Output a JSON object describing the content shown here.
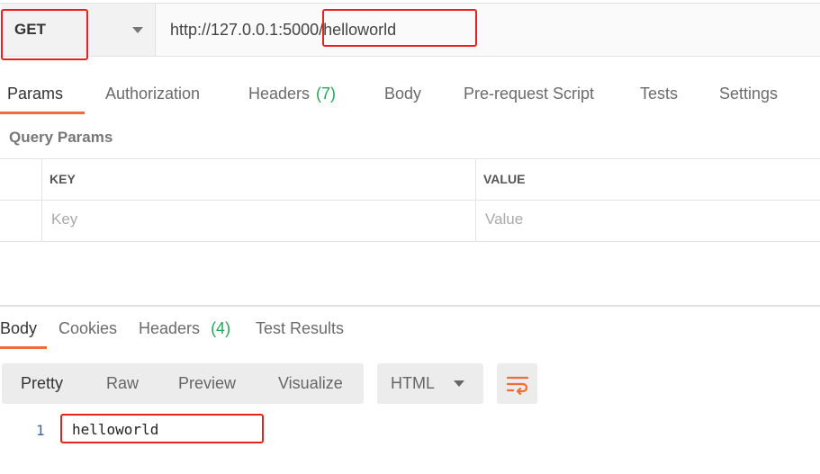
{
  "request": {
    "method": "GET",
    "url": "http://127.0.0.1:5000/helloworld"
  },
  "request_tabs": [
    {
      "label": "Params",
      "count": "",
      "active": true
    },
    {
      "label": "Authorization",
      "count": ""
    },
    {
      "label": "Headers",
      "count": "(7)"
    },
    {
      "label": "Body",
      "count": ""
    },
    {
      "label": "Pre-request Script",
      "count": ""
    },
    {
      "label": "Tests",
      "count": ""
    },
    {
      "label": "Settings",
      "count": ""
    }
  ],
  "query_params": {
    "title": "Query Params",
    "columns": [
      "KEY",
      "VALUE"
    ],
    "placeholders": [
      "Key",
      "Value"
    ]
  },
  "response_tabs": [
    {
      "label": "Body",
      "count": "",
      "active": true
    },
    {
      "label": "Cookies",
      "count": ""
    },
    {
      "label": "Headers",
      "count": "(4)"
    },
    {
      "label": "Test Results",
      "count": ""
    }
  ],
  "view_modes": [
    "Pretty",
    "Raw",
    "Preview",
    "Visualize"
  ],
  "active_view": "Pretty",
  "language": "HTML",
  "response_body": {
    "line_number": "1",
    "text": "helloworld"
  },
  "colors": {
    "accent": "#f26b3a",
    "count": "#26a65b",
    "highlight": "#e5231b"
  },
  "icons": {
    "method_caret": "chevron-down-icon",
    "language_caret": "chevron-down-icon",
    "wrap": "wrap-lines-icon"
  }
}
